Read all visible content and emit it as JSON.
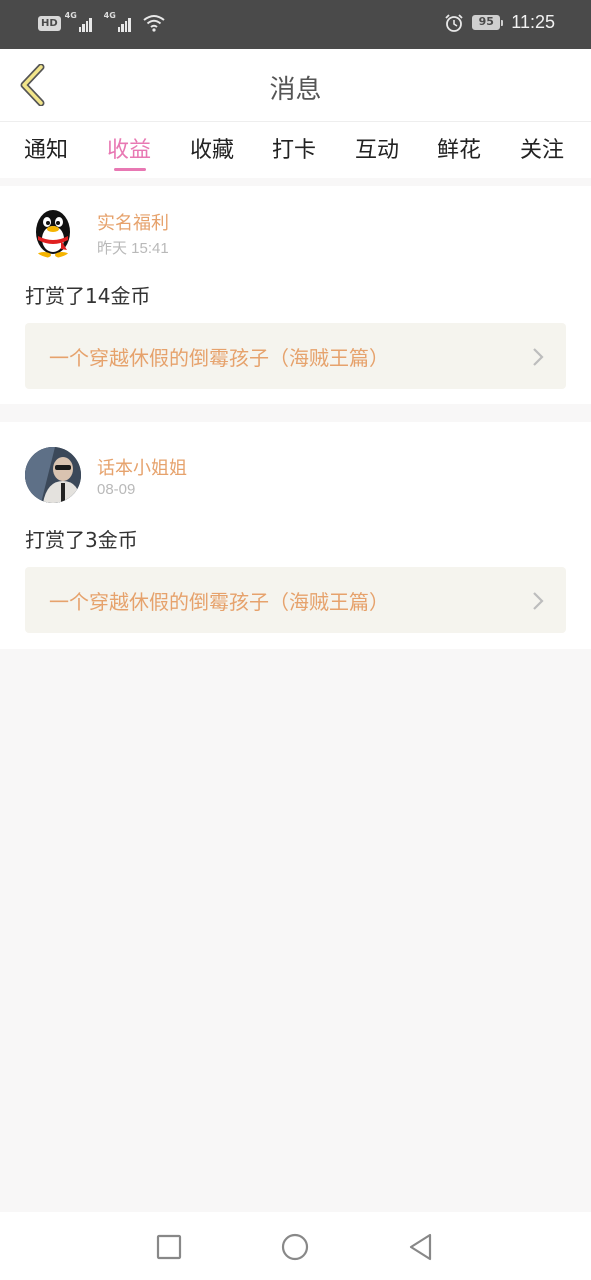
{
  "status_bar": {
    "hd_label": "HD",
    "network1": "4G",
    "network2": "4G",
    "battery": "95",
    "time": "11:25",
    "icons": [
      "hd-icon",
      "signal-icon",
      "signal-icon",
      "wifi-icon",
      "alarm-icon",
      "battery-icon"
    ]
  },
  "header": {
    "title": "消息",
    "back_icon": "chevron-left-icon"
  },
  "tabs": [
    {
      "label": "通知",
      "active": false
    },
    {
      "label": "收益",
      "active": true
    },
    {
      "label": "收藏",
      "active": false
    },
    {
      "label": "打卡",
      "active": false
    },
    {
      "label": "互动",
      "active": false
    },
    {
      "label": "鲜花",
      "active": false
    },
    {
      "label": "关注",
      "active": false
    }
  ],
  "messages": [
    {
      "username": "实名福利",
      "time": "昨天 15:41",
      "text": "打赏了14金币",
      "book_title": "一个穿越休假的倒霉孩子（海贼王篇）",
      "avatar": "penguin-avatar"
    },
    {
      "username": "话本小姐姐",
      "time": "08-09",
      "text": "打赏了3金币",
      "book_title": "一个穿越休假的倒霉孩子（海贼王篇）",
      "avatar": "photo-avatar"
    }
  ],
  "colors": {
    "accent": "#e878b3",
    "username": "#e6a26c",
    "status_bar": "#4a4a4a",
    "page_bg": "#f8f7f7",
    "book_bg": "#f5f4ee"
  }
}
